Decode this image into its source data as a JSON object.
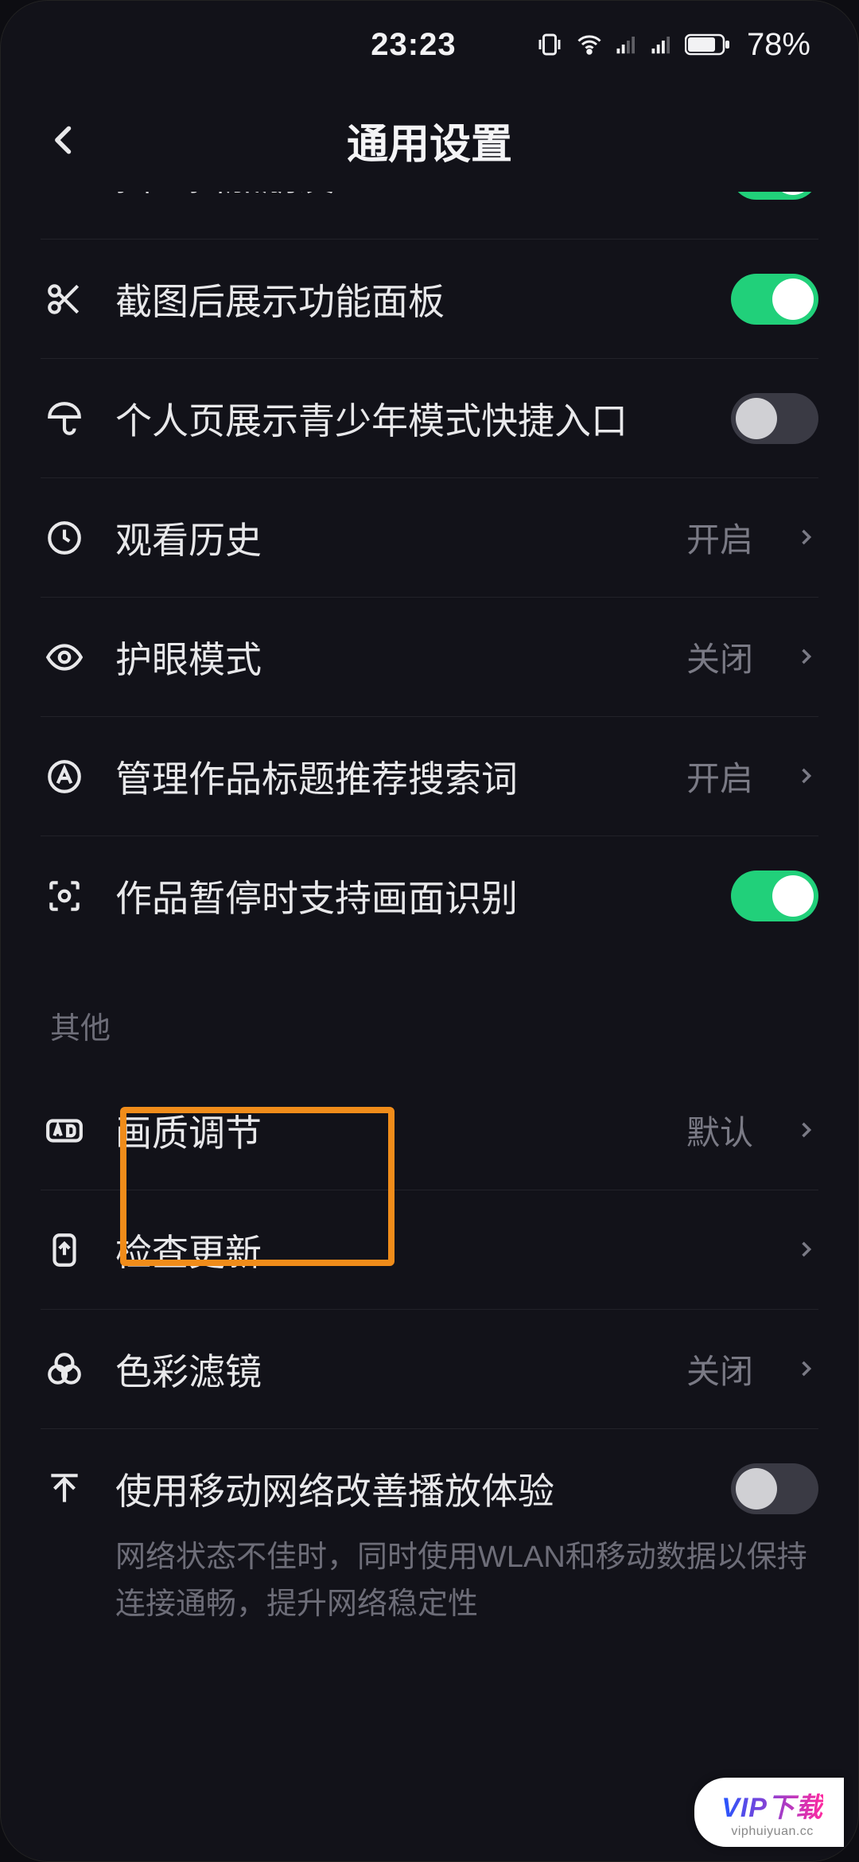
{
  "status": {
    "time": "23:23",
    "battery_pct": "78%"
  },
  "header": {
    "title": "通用设置"
  },
  "rows": {
    "shake": {
      "label": "摇一摇加朋友"
    },
    "screenshot": {
      "label": "截图后展示功能面板"
    },
    "teen": {
      "label": "个人页展示青少年模式快捷入口"
    },
    "history": {
      "label": "观看历史",
      "value": "开启"
    },
    "eyecare": {
      "label": "护眼模式",
      "value": "关闭"
    },
    "title_rec": {
      "label": "管理作品标题推荐搜索词",
      "value": "开启"
    },
    "pause_rec": {
      "label": "作品暂停时支持画面识别"
    },
    "section_other": "其他",
    "quality": {
      "label": "画质调节",
      "value": "默认"
    },
    "update": {
      "label": "检查更新"
    },
    "filter": {
      "label": "色彩滤镜",
      "value": "关闭"
    },
    "mobile_net": {
      "label": "使用移动网络改善播放体验",
      "desc": "网络状态不佳时，同时使用WLAN和移动数据以保持连接通畅，提升网络稳定性"
    }
  },
  "watermark": {
    "main": "VIP下载",
    "sub": "viphuiyuan.cc"
  }
}
